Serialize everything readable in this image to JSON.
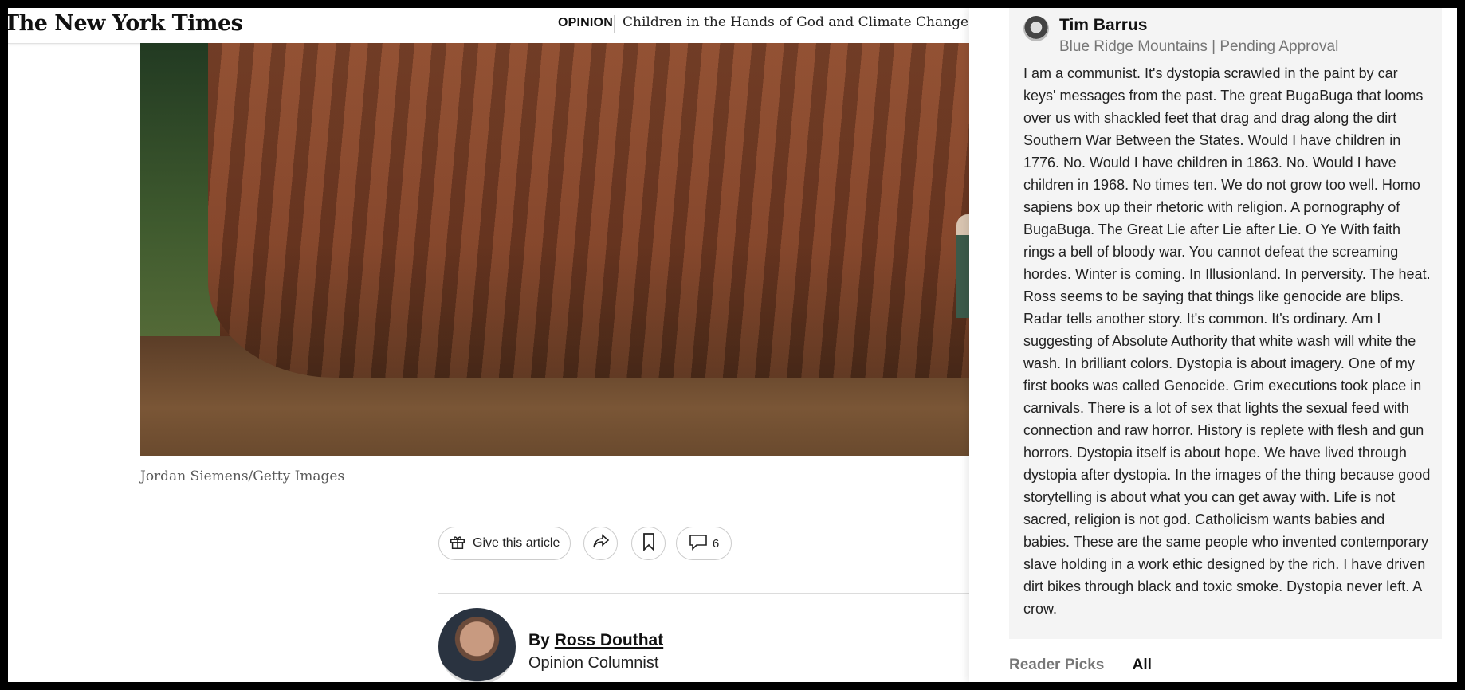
{
  "header": {
    "logo": "The New York Times",
    "section": "OPINION",
    "headline": "Children in the Hands of God and Climate Change"
  },
  "article": {
    "photo_credit": "Jordan Siemens/Getty Images",
    "tools": {
      "gift_label": "Give this article",
      "comment_count": "6"
    },
    "byline_prefix": "By",
    "author_name": "Ross Douthat",
    "author_role": "Opinion Columnist"
  },
  "comment_panel": {
    "commenter": "Tim Barrus",
    "meta": "Blue Ridge Mountains | Pending Approval",
    "text": "I am a communist. It's dystopia scrawled in the paint by car keys' messages from the past. The great BugaBuga that looms over us with shackled feet that drag and drag along the dirt Southern War Between the States. Would I have children in 1776. No. Would I have children in 1863. No. Would I have children in 1968. No times ten. We do not grow too well. Homo sapiens box up their rhetoric with religion. A pornography of BugaBuga. The Great Lie after Lie after Lie. O Ye With faith rings a bell of bloody war. You cannot defeat the screaming hordes. Winter is coming. In Illusionland. In perversity. The heat. Ross seems to be saying that things like genocide are blips. Radar tells another story. It's common. It's ordinary.  Am I suggesting of Absolute Authority that white wash will white the wash. In brilliant colors. Dystopia is about imagery. One of my first books was called Genocide. Grim executions took place in carnivals. There is a lot of sex that lights the sexual feed with connection and raw horror. History is replete with flesh and gun horrors. Dystopia itself is about hope. We have lived through dystopia after dystopia. In the images of the thing because good storytelling is about what you can get away with. Life is not sacred, religion is not god. Catholicism wants babies and babies. These are the same people who invented contemporary slave holding in a work ethic designed by the rich. I have driven dirt bikes through black and toxic smoke. Dystopia never left. A crow.",
    "tabs": [
      "Reader Picks",
      "All"
    ]
  }
}
